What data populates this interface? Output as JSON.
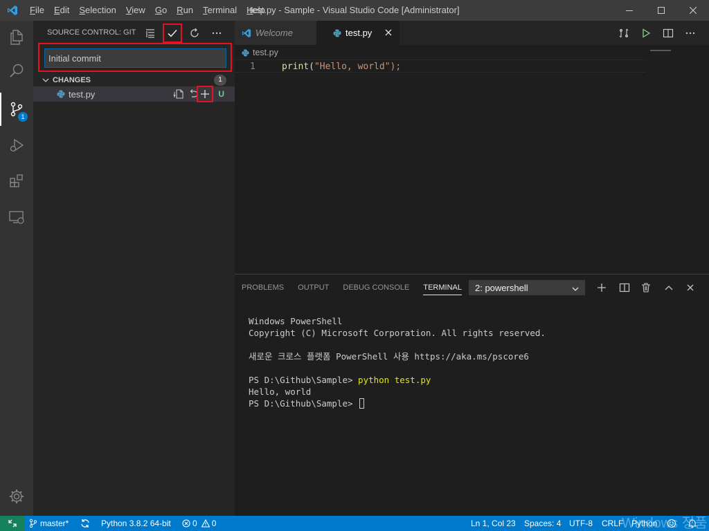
{
  "window": {
    "title": "test.py - Sample - Visual Studio Code [Administrator]"
  },
  "menu": [
    {
      "label": "File",
      "mnemonic": "F",
      "rest": "ile"
    },
    {
      "label": "Edit",
      "mnemonic": "E",
      "rest": "dit"
    },
    {
      "label": "Selection",
      "mnemonic": "S",
      "rest": "election"
    },
    {
      "label": "View",
      "mnemonic": "V",
      "rest": "iew"
    },
    {
      "label": "Go",
      "mnemonic": "G",
      "rest": "o"
    },
    {
      "label": "Run",
      "mnemonic": "R",
      "rest": "un"
    },
    {
      "label": "Terminal",
      "mnemonic": "T",
      "rest": "erminal"
    },
    {
      "label": "Help",
      "mnemonic": "H",
      "rest": "elp"
    }
  ],
  "activity_bar": {
    "items": [
      "explorer-icon",
      "search-icon",
      "source-control-icon",
      "run-debug-icon",
      "extensions-icon",
      "remote-explorer-icon"
    ],
    "source_control_badge": "1",
    "settings_icon": "gear-icon"
  },
  "source_control": {
    "title": "SOURCE CONTROL: GIT",
    "commit_message": "Initial commit",
    "changes_label": "CHANGES",
    "changes_count": "1",
    "files": [
      {
        "name": "test.py",
        "status": "U"
      }
    ]
  },
  "editor": {
    "tabs": [
      {
        "label": "Welcome",
        "active": false
      },
      {
        "label": "test.py",
        "active": true
      }
    ],
    "breadcrumb": "test.py",
    "lines": [
      {
        "number": "1",
        "fn": "print",
        "open": "(",
        "string": "\"Hello, world\"",
        "close": ");"
      }
    ]
  },
  "panel": {
    "tabs": [
      "PROBLEMS",
      "OUTPUT",
      "DEBUG CONSOLE",
      "TERMINAL"
    ],
    "active_tab": "TERMINAL",
    "terminal_select": "2: powershell",
    "terminal": {
      "line1": "Windows PowerShell",
      "line2": "Copyright (C) Microsoft Corporation. All rights reserved.",
      "line3": "",
      "line4": "새로운 크로스 플랫폼 PowerShell 사용 https://aka.ms/pscore6",
      "line5": "",
      "prompt1": "PS D:\\Github\\Sample> ",
      "command1": "python test.py",
      "line6": "Hello, world",
      "prompt2": "PS D:\\Github\\Sample> "
    }
  },
  "status_bar": {
    "branch": "master*",
    "interpreter": "Python 3.8.2 64-bit",
    "errors": "0",
    "warnings": "0",
    "position": "Ln 1, Col 23",
    "spaces": "Spaces: 4",
    "encoding": "UTF-8",
    "eol": "CRLF",
    "language": "Python",
    "watermark": "Windows 정품"
  },
  "colors": {
    "accent": "#007acc",
    "highlight": "#e81123",
    "untracked": "#73c991"
  }
}
